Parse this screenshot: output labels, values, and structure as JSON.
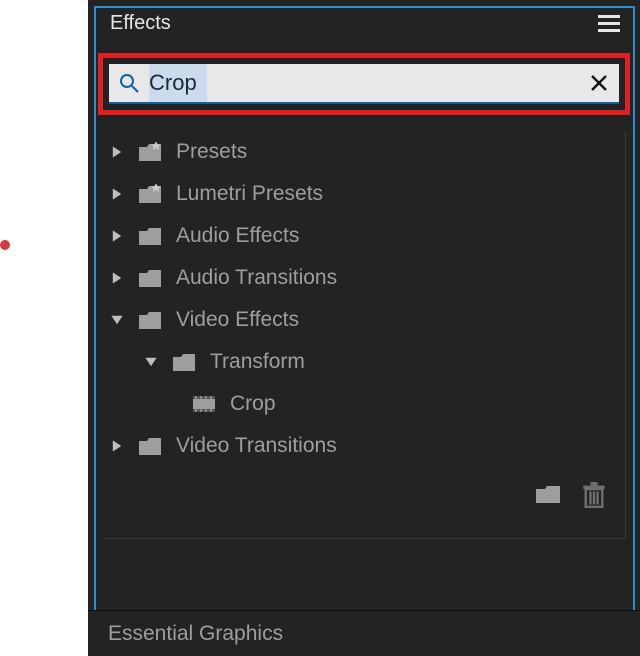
{
  "panel_title": "Effects",
  "footer_panel": "Essential Graphics",
  "search": {
    "value": "Crop"
  },
  "effects_tree": [
    {
      "label": "Presets",
      "expanded": false,
      "icon": "folder-starred",
      "depth": 0
    },
    {
      "label": "Lumetri Presets",
      "expanded": false,
      "icon": "folder-starred",
      "depth": 0
    },
    {
      "label": "Audio Effects",
      "expanded": false,
      "icon": "folder",
      "depth": 0
    },
    {
      "label": "Audio Transitions",
      "expanded": false,
      "icon": "folder",
      "depth": 0
    },
    {
      "label": "Video Effects",
      "expanded": true,
      "icon": "folder",
      "depth": 0
    },
    {
      "label": "Transform",
      "expanded": true,
      "icon": "folder",
      "depth": 1
    },
    {
      "label": "Crop",
      "expanded": null,
      "icon": "effect",
      "depth": 2
    },
    {
      "label": "Video Transitions",
      "expanded": false,
      "icon": "folder",
      "depth": 0
    }
  ]
}
